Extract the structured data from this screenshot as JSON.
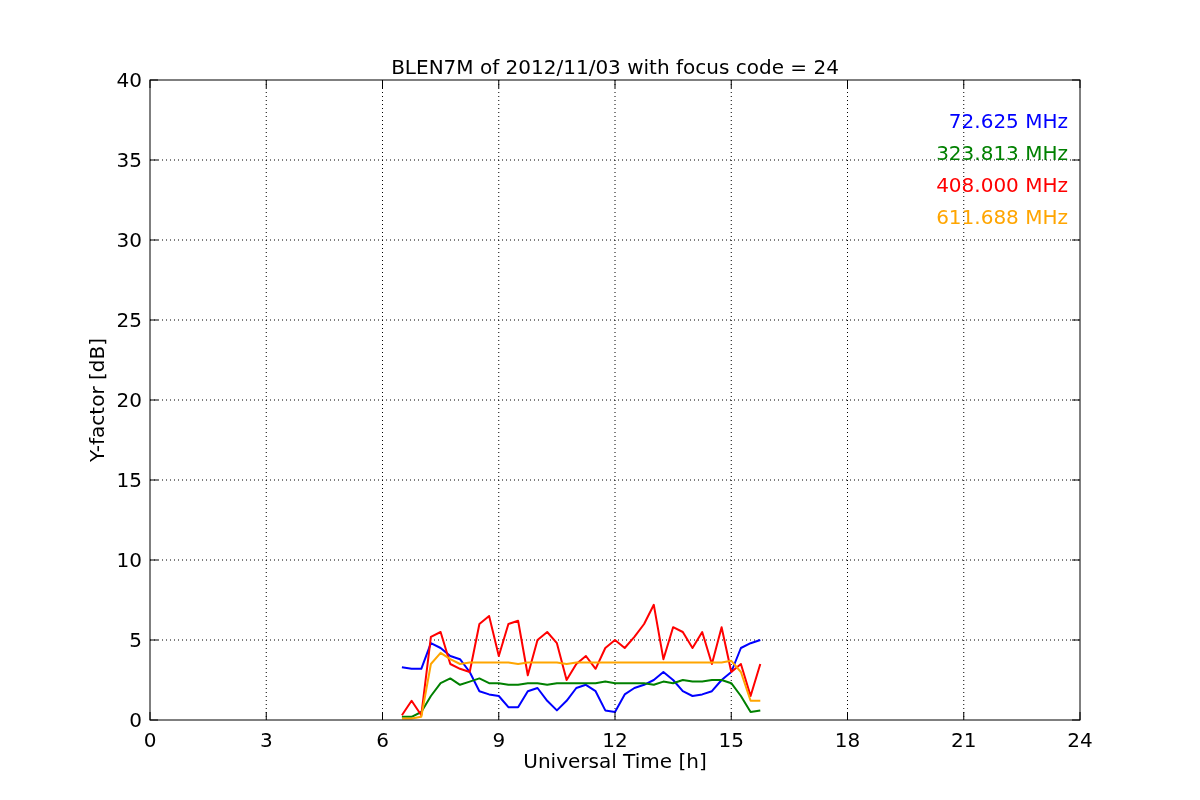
{
  "chart": {
    "chart_data": {
      "type": "line",
      "title": "BLEN7M of 2012/11/03 with focus code = 24",
      "xlabel": "Universal Time [h]",
      "ylabel": "Y-factor [dB]",
      "x": [
        6.5,
        6.75,
        7.0,
        7.25,
        7.5,
        7.75,
        8.0,
        8.25,
        8.5,
        8.75,
        9.0,
        9.25,
        9.5,
        9.75,
        10.0,
        10.25,
        10.5,
        10.75,
        11.0,
        11.25,
        11.5,
        11.75,
        12.0,
        12.25,
        12.5,
        12.75,
        13.0,
        13.25,
        13.5,
        13.75,
        14.0,
        14.25,
        14.5,
        14.75,
        15.0,
        15.25,
        15.5,
        15.75
      ],
      "series": [
        {
          "name": "72.625 MHz",
          "color": "#0000ff",
          "values": [
            3.3,
            3.2,
            3.2,
            4.8,
            4.5,
            4.0,
            3.8,
            3.0,
            1.8,
            1.6,
            1.5,
            0.8,
            0.8,
            1.8,
            2.0,
            1.2,
            0.6,
            1.2,
            2.0,
            2.2,
            1.8,
            0.6,
            0.5,
            1.6,
            2.0,
            2.2,
            2.5,
            3.0,
            2.5,
            1.8,
            1.5,
            1.6,
            1.8,
            2.5,
            3.0,
            4.5,
            4.8,
            5.0
          ]
        },
        {
          "name": "323.813 MHz",
          "color": "#008000",
          "values": [
            0.2,
            0.2,
            0.5,
            1.5,
            2.3,
            2.6,
            2.2,
            2.4,
            2.6,
            2.3,
            2.3,
            2.2,
            2.2,
            2.3,
            2.3,
            2.2,
            2.3,
            2.3,
            2.3,
            2.3,
            2.3,
            2.4,
            2.3,
            2.3,
            2.3,
            2.3,
            2.2,
            2.4,
            2.3,
            2.5,
            2.4,
            2.4,
            2.5,
            2.5,
            2.3,
            1.5,
            0.5,
            0.6
          ]
        },
        {
          "name": "408.000 MHz",
          "color": "#ff0000",
          "values": [
            0.3,
            1.2,
            0.3,
            5.2,
            5.5,
            3.5,
            3.2,
            3.0,
            6.0,
            6.5,
            4.0,
            6.0,
            6.2,
            2.8,
            5.0,
            5.5,
            4.8,
            2.5,
            3.5,
            4.0,
            3.2,
            4.5,
            5.0,
            4.5,
            5.2,
            6.0,
            7.2,
            3.8,
            5.8,
            5.5,
            4.5,
            5.5,
            3.5,
            5.8,
            3.0,
            3.5,
            1.5,
            3.5
          ]
        },
        {
          "name": "611.688 MHz",
          "color": "#ffa500",
          "values": [
            0.1,
            0.1,
            0.2,
            3.5,
            4.2,
            3.8,
            3.5,
            3.6,
            3.6,
            3.6,
            3.6,
            3.6,
            3.5,
            3.6,
            3.6,
            3.6,
            3.6,
            3.5,
            3.6,
            3.6,
            3.6,
            3.6,
            3.6,
            3.6,
            3.6,
            3.6,
            3.6,
            3.6,
            3.6,
            3.6,
            3.6,
            3.6,
            3.6,
            3.6,
            3.7,
            3.0,
            1.2,
            1.2
          ]
        }
      ],
      "grid": true,
      "xlim": [
        0,
        24
      ],
      "ylim": [
        0,
        40
      ],
      "xticks": [
        0,
        3,
        6,
        9,
        12,
        15,
        18,
        21,
        24
      ],
      "yticks": [
        0,
        5,
        10,
        15,
        20,
        25,
        30,
        35,
        40
      ]
    }
  }
}
